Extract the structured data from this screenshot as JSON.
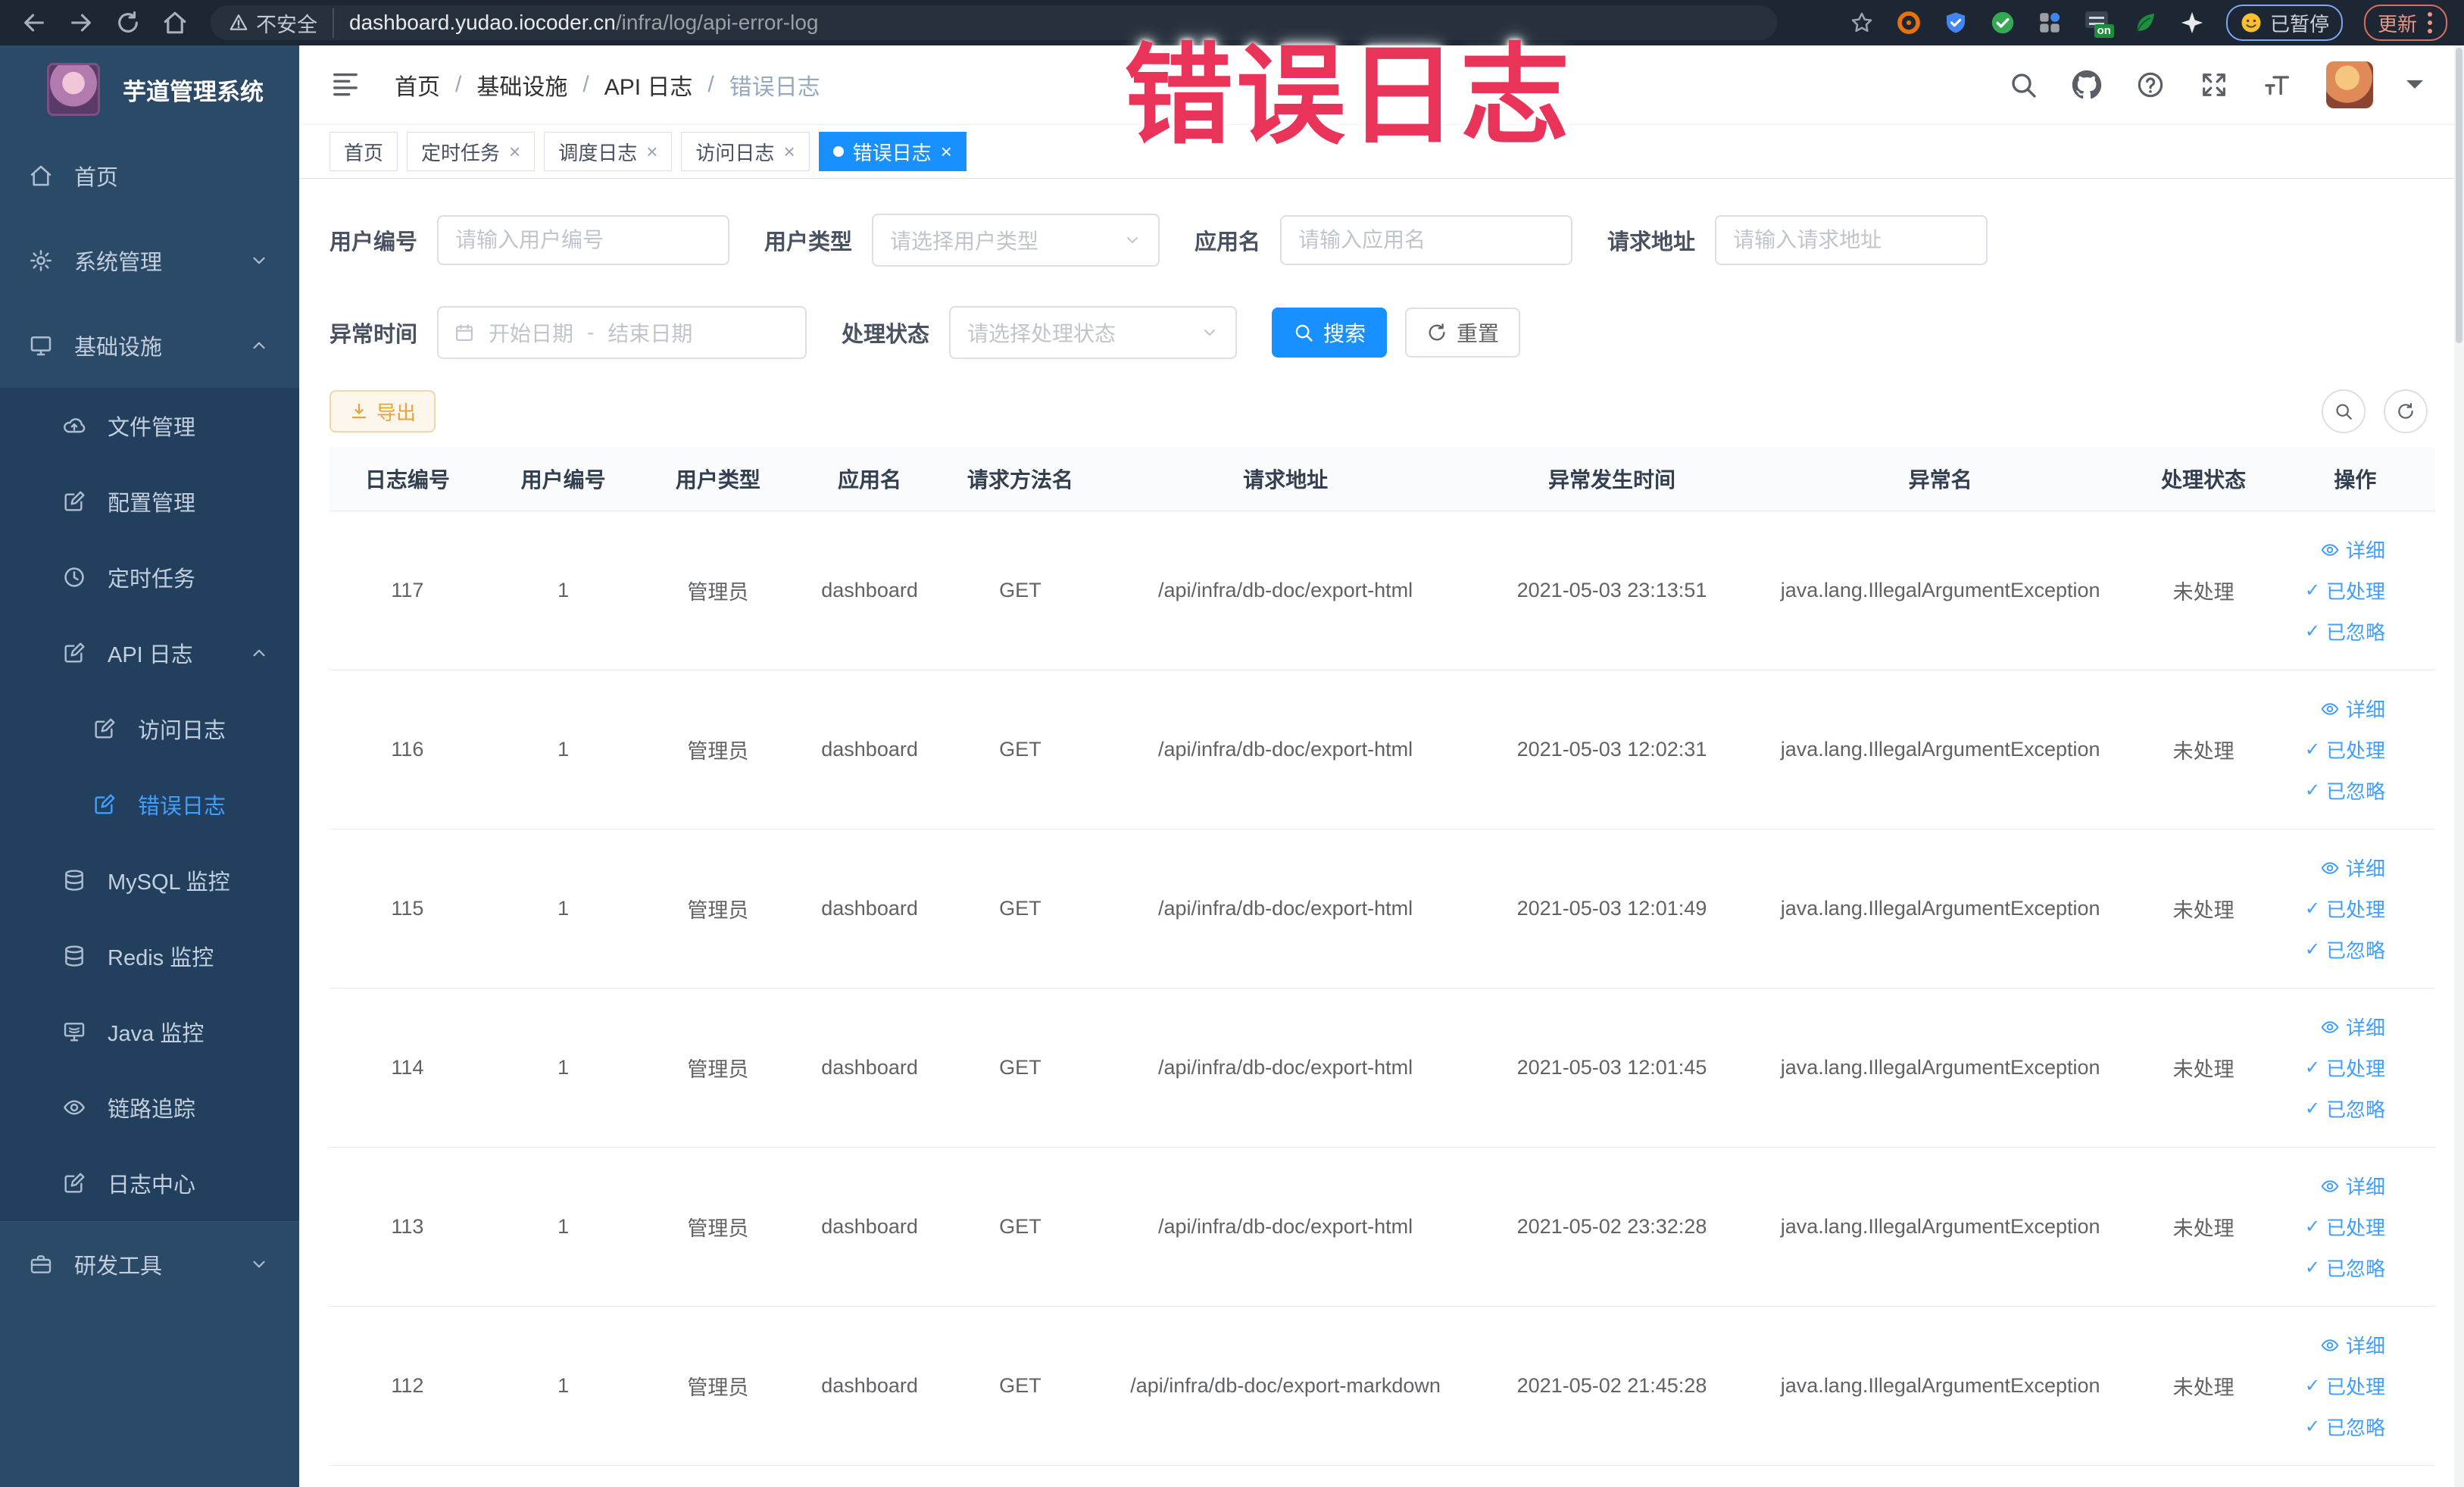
{
  "browser": {
    "security_label": "不安全",
    "url_domain": "dashboard.yudao.iocoder.cn",
    "url_path": "/infra/log/api-error-log",
    "onoff_label": "on",
    "paused_label": "已暂停",
    "update_label": "更新"
  },
  "annotation": {
    "text": "错误日志"
  },
  "sidebar": {
    "title": "芋道管理系统",
    "items": [
      {
        "label": "首页"
      },
      {
        "label": "系统管理"
      },
      {
        "label": "基础设施"
      },
      {
        "label": "文件管理"
      },
      {
        "label": "配置管理"
      },
      {
        "label": "定时任务"
      },
      {
        "label": "API 日志"
      },
      {
        "label": "访问日志"
      },
      {
        "label": "错误日志"
      },
      {
        "label": "MySQL 监控"
      },
      {
        "label": "Redis 监控"
      },
      {
        "label": "Java 监控"
      },
      {
        "label": "链路追踪"
      },
      {
        "label": "日志中心"
      },
      {
        "label": "研发工具"
      }
    ]
  },
  "breadcrumb": {
    "separator": "/",
    "items": [
      "首页",
      "基础设施",
      "API 日志",
      "错误日志"
    ]
  },
  "tabs": [
    {
      "label": "首页"
    },
    {
      "label": "定时任务"
    },
    {
      "label": "调度日志"
    },
    {
      "label": "访问日志"
    },
    {
      "label": "错误日志"
    }
  ],
  "filters": {
    "user_id": {
      "label": "用户编号",
      "placeholder": "请输入用户编号"
    },
    "user_type": {
      "label": "用户类型",
      "placeholder": "请选择用户类型"
    },
    "app_name": {
      "label": "应用名",
      "placeholder": "请输入应用名"
    },
    "request_url": {
      "label": "请求地址",
      "placeholder": "请输入请求地址"
    },
    "exception_time": {
      "label": "异常时间",
      "start_placeholder": "开始日期",
      "separator": "-",
      "end_placeholder": "结束日期"
    },
    "process_status": {
      "label": "处理状态",
      "placeholder": "请选择处理状态"
    },
    "search_label": "搜索",
    "reset_label": "重置"
  },
  "toolbar": {
    "export_label": "导出"
  },
  "table": {
    "columns": [
      "日志编号",
      "用户编号",
      "用户类型",
      "应用名",
      "请求方法名",
      "请求地址",
      "异常发生时间",
      "异常名",
      "处理状态",
      "操作"
    ],
    "action_labels": [
      "详细",
      "已处理",
      "已忽略"
    ],
    "rows": [
      {
        "id": "117",
        "user_id": "1",
        "user_type": "管理员",
        "app_name": "dashboard",
        "method": "GET",
        "url": "/api/infra/db-doc/export-html",
        "time": "2021-05-03 23:13:51",
        "exception": "java.lang.IllegalArgumentException",
        "status": "未处理"
      },
      {
        "id": "116",
        "user_id": "1",
        "user_type": "管理员",
        "app_name": "dashboard",
        "method": "GET",
        "url": "/api/infra/db-doc/export-html",
        "time": "2021-05-03 12:02:31",
        "exception": "java.lang.IllegalArgumentException",
        "status": "未处理"
      },
      {
        "id": "115",
        "user_id": "1",
        "user_type": "管理员",
        "app_name": "dashboard",
        "method": "GET",
        "url": "/api/infra/db-doc/export-html",
        "time": "2021-05-03 12:01:49",
        "exception": "java.lang.IllegalArgumentException",
        "status": "未处理"
      },
      {
        "id": "114",
        "user_id": "1",
        "user_type": "管理员",
        "app_name": "dashboard",
        "method": "GET",
        "url": "/api/infra/db-doc/export-html",
        "time": "2021-05-03 12:01:45",
        "exception": "java.lang.IllegalArgumentException",
        "status": "未处理"
      },
      {
        "id": "113",
        "user_id": "1",
        "user_type": "管理员",
        "app_name": "dashboard",
        "method": "GET",
        "url": "/api/infra/db-doc/export-html",
        "time": "2021-05-02 23:32:28",
        "exception": "java.lang.IllegalArgumentException",
        "status": "未处理"
      },
      {
        "id": "112",
        "user_id": "1",
        "user_type": "管理员",
        "app_name": "dashboard",
        "method": "GET",
        "url": "/api/infra/db-doc/export-markdown",
        "time": "2021-05-02 21:45:28",
        "exception": "java.lang.IllegalArgumentException",
        "status": "未处理"
      }
    ]
  },
  "colors": {
    "accent": "#1890ff",
    "link": "#409eff",
    "warning": "#e6a23c",
    "annotation": "#ea3358"
  }
}
